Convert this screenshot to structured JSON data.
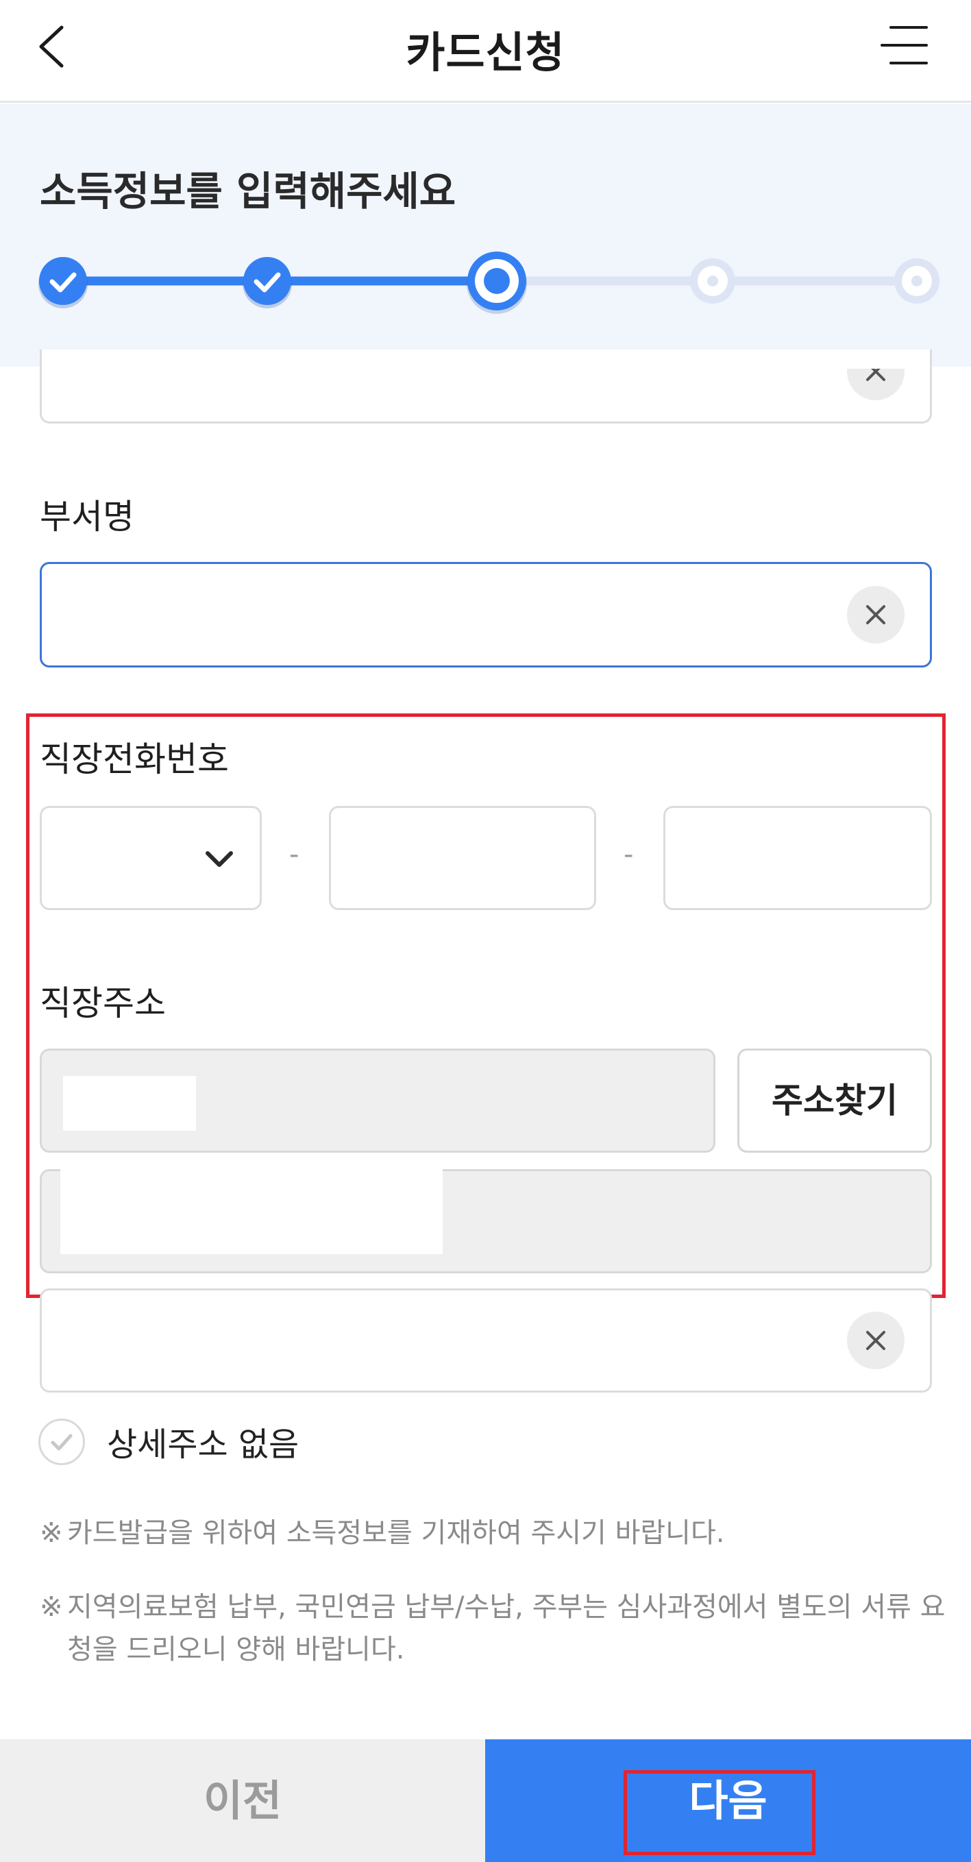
{
  "header": {
    "title": "카드신청",
    "back_icon": "chevron-left-icon",
    "menu_icon": "hamburger-menu-icon"
  },
  "progress": {
    "title": "소득정보를 입력해주세요",
    "steps_total": 5,
    "current_step": 3,
    "completed_steps": 2,
    "active_color": "#3480f2",
    "inactive_color": "#dde4f3"
  },
  "form": {
    "department": {
      "label": "부서명",
      "value": "",
      "clear_icon": "close-icon"
    },
    "work_phone": {
      "label": "직장전화번호",
      "area_code_value": "",
      "separator": "-",
      "dropdown_icon": "chevron-down-icon"
    },
    "work_address": {
      "label": "직장주소",
      "search_button": "주소찾기"
    },
    "no_detail_address": {
      "label": "상세주소 없음",
      "checked": false,
      "check_icon": "check-icon"
    }
  },
  "notices": [
    "카드발급을 위하여 소득정보를 기재하여 주시기 바랍니다.",
    "지역의료보험 납부, 국민연금 납부/수납, 주부는 심사과정에서 별도의 서류 요청을 드리오니 양해 바랍니다."
  ],
  "notice_mark": "※",
  "footer": {
    "prev_label": "이전",
    "next_label": "다음"
  },
  "colors": {
    "accent": "#3480f2",
    "highlight": "#e02530",
    "focus_border": "#3c76d6"
  }
}
